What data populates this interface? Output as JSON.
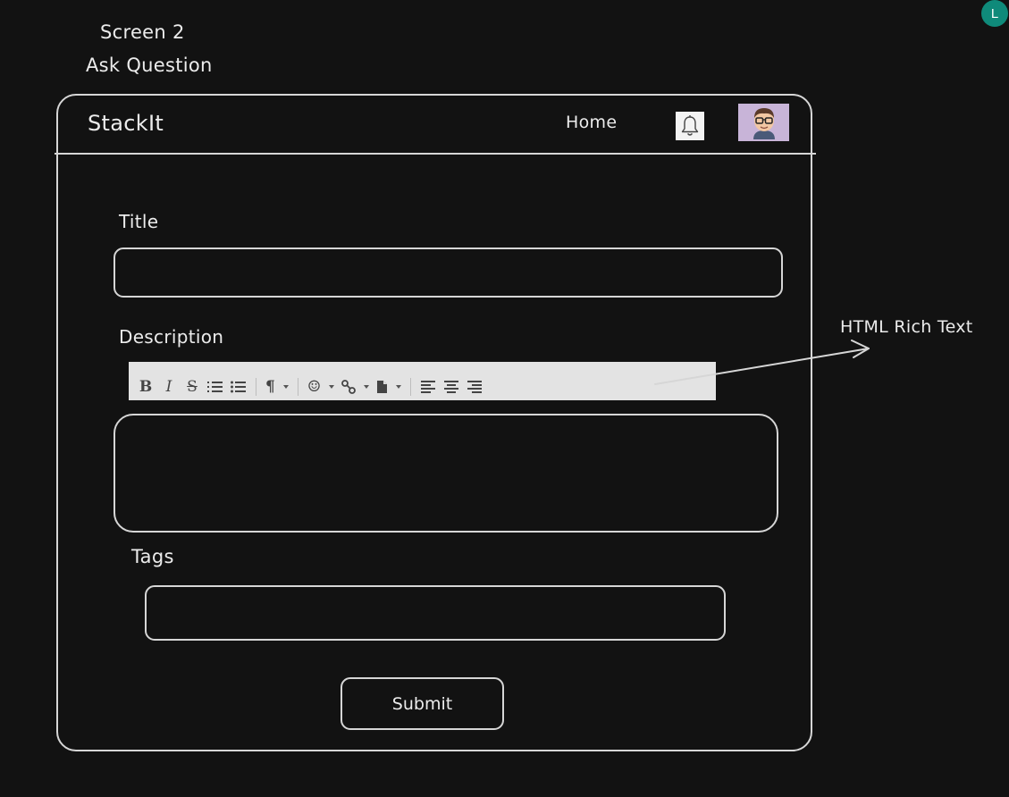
{
  "canvas": {
    "screen_label": "Screen 2",
    "screen_title": "Ask Question",
    "collaborator_initial": "L",
    "annotation": "HTML Rich Text"
  },
  "navbar": {
    "brand": "StackIt",
    "home_label": "Home",
    "notification_icon": "bell-icon",
    "profile_icon": "avatar-icon"
  },
  "form": {
    "title_label": "Title",
    "title_value": "",
    "description_label": "Description",
    "description_value": "",
    "tags_label": "Tags",
    "tags_value": "",
    "submit_label": "Submit"
  },
  "toolbar": {
    "bold": "B",
    "italic": "I",
    "strike": "S",
    "ordered_list": "ordered-list-icon",
    "bullet_list": "bullet-list-icon",
    "paragraph": "¶",
    "emoji": "☺",
    "link": "link-icon",
    "file": "file-icon",
    "align_left": "align-left-icon",
    "align_center": "align-center-icon",
    "align_right": "align-right-icon"
  },
  "colors": {
    "background": "#121212",
    "stroke": "#d6d6d6",
    "toolbar": "#e3e3e3",
    "badge": "#0f8a7a",
    "avatar_bg": "#c8b4d8"
  }
}
